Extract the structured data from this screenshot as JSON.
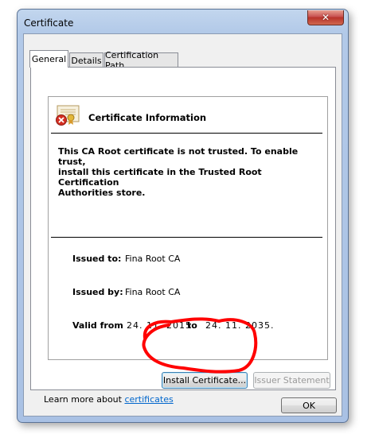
{
  "window": {
    "title": "Certificate",
    "close_glyph": "✕"
  },
  "tabs": [
    {
      "label": "General",
      "active": true
    },
    {
      "label": "Details",
      "active": false
    },
    {
      "label": "Certification Path",
      "active": false
    }
  ],
  "certificate": {
    "heading": "Certificate Information",
    "message": "This CA Root certificate is not trusted. To enable trust,\ninstall this certificate in the Trusted Root Certification\nAuthorities store.",
    "issued_to_label": "Issued to:",
    "issued_to": "Fina Root CA",
    "issued_by_label": "Issued by:",
    "issued_by": "Fina Root CA",
    "valid_from_label": "Valid from",
    "valid_from": "24. 11. 2015.",
    "valid_to_label": "to",
    "valid_to": "24. 11. 2035."
  },
  "buttons": {
    "install": "Install Certificate...",
    "issuer_statement": "Issuer Statement",
    "ok": "OK"
  },
  "learn_more": {
    "prefix": "Learn more about ",
    "link": "certificates"
  },
  "icons": {
    "certificate": "certificate-untrusted-icon",
    "close": "close-icon"
  },
  "colors": {
    "annotation": "#ff0000",
    "link": "#0066cc",
    "error_badge": "#d42f22"
  }
}
